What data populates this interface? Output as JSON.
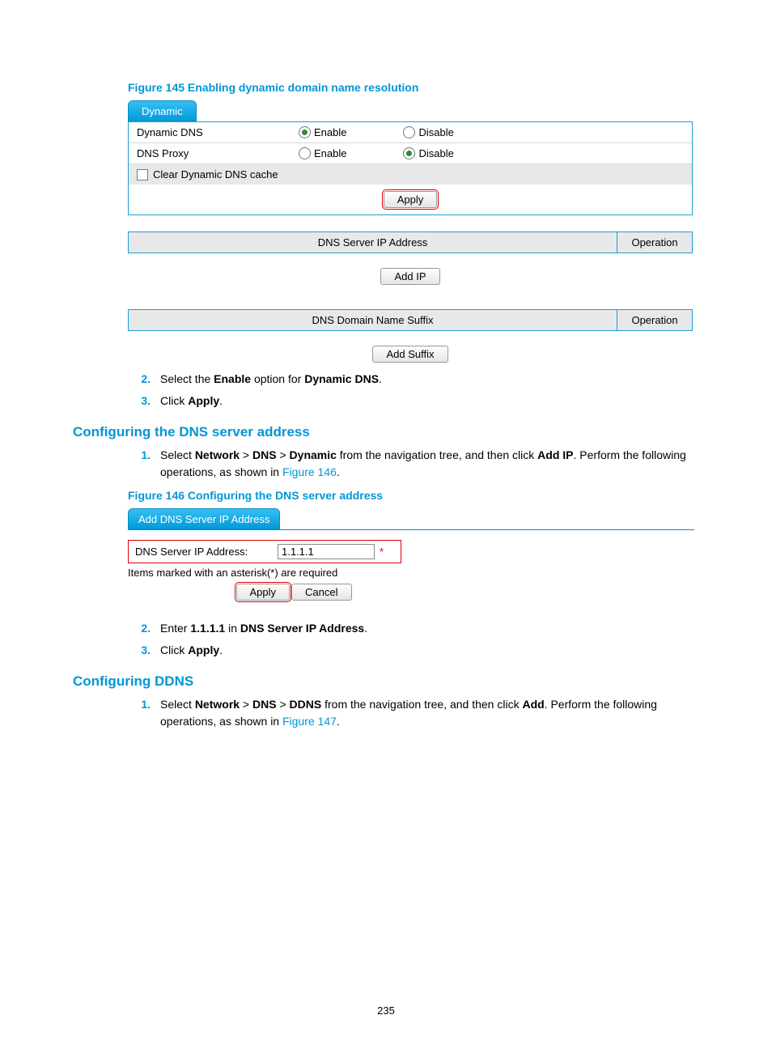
{
  "figure145": {
    "caption": "Figure 145 Enabling dynamic domain name resolution",
    "tab_label": "Dynamic",
    "row_dynamic_dns": "Dynamic DNS",
    "row_dns_proxy": "DNS Proxy",
    "enable_label": "Enable",
    "disable_label": "Disable",
    "clear_cache_label": "Clear Dynamic DNS cache",
    "apply": "Apply",
    "table1_header": "DNS Server IP Address",
    "table1_operation": "Operation",
    "add_ip": "Add IP",
    "table2_header": "DNS Domain Name Suffix",
    "table2_operation": "Operation",
    "add_suffix": "Add Suffix"
  },
  "step145b": {
    "num2": "2.",
    "text2_a": "Select the ",
    "text2_b_bold": "Enable",
    "text2_c": " option for ",
    "text2_d_bold": "Dynamic DNS",
    "text2_e": ".",
    "num3": "3.",
    "text3_a": "Click ",
    "text3_b_bold": "Apply",
    "text3_c": "."
  },
  "sectionA": {
    "title": "Configuring the DNS server address",
    "num1": "1.",
    "text1_a": "Select ",
    "text1_b_bold": "Network",
    "gt1": " > ",
    "text1_c_bold": "DNS",
    "gt2": " > ",
    "text1_d_bold": "Dynamic",
    "text1_e": " from the navigation tree, and then click ",
    "text1_f_bold": "Add IP",
    "text1_g": ". Perform the following operations, as shown in ",
    "figref": "Figure 146",
    "text1_h": "."
  },
  "figure146": {
    "caption": "Figure 146 Configuring the DNS server address",
    "tab_label": "Add DNS Server IP Address",
    "field_label": "DNS Server IP Address:",
    "field_value": "1.1.1.1",
    "asterisk": "*",
    "note": "Items marked with an asterisk(*) are required",
    "apply": "Apply",
    "cancel": "Cancel"
  },
  "step146b": {
    "num2": "2.",
    "text2_a": "Enter ",
    "text2_b_bold": "1.1.1.1",
    "text2_c": " in ",
    "text2_d_bold": "DNS Server IP Address",
    "text2_e": ".",
    "num3": "3.",
    "text3_a": "Click ",
    "text3_b_bold": "Apply",
    "text3_c": "."
  },
  "sectionB": {
    "title": "Configuring DDNS",
    "num1": "1.",
    "text1_a": "Select ",
    "text1_b_bold": "Network",
    "gt1": " > ",
    "text1_c_bold": "DNS",
    "gt2": " > ",
    "text1_d_bold": "DDNS",
    "text1_e": " from the navigation tree, and then click ",
    "text1_f_bold": "Add",
    "text1_g": ". Perform the following operations, as shown in ",
    "figref": "Figure 147",
    "text1_h": "."
  },
  "page_number": "235"
}
